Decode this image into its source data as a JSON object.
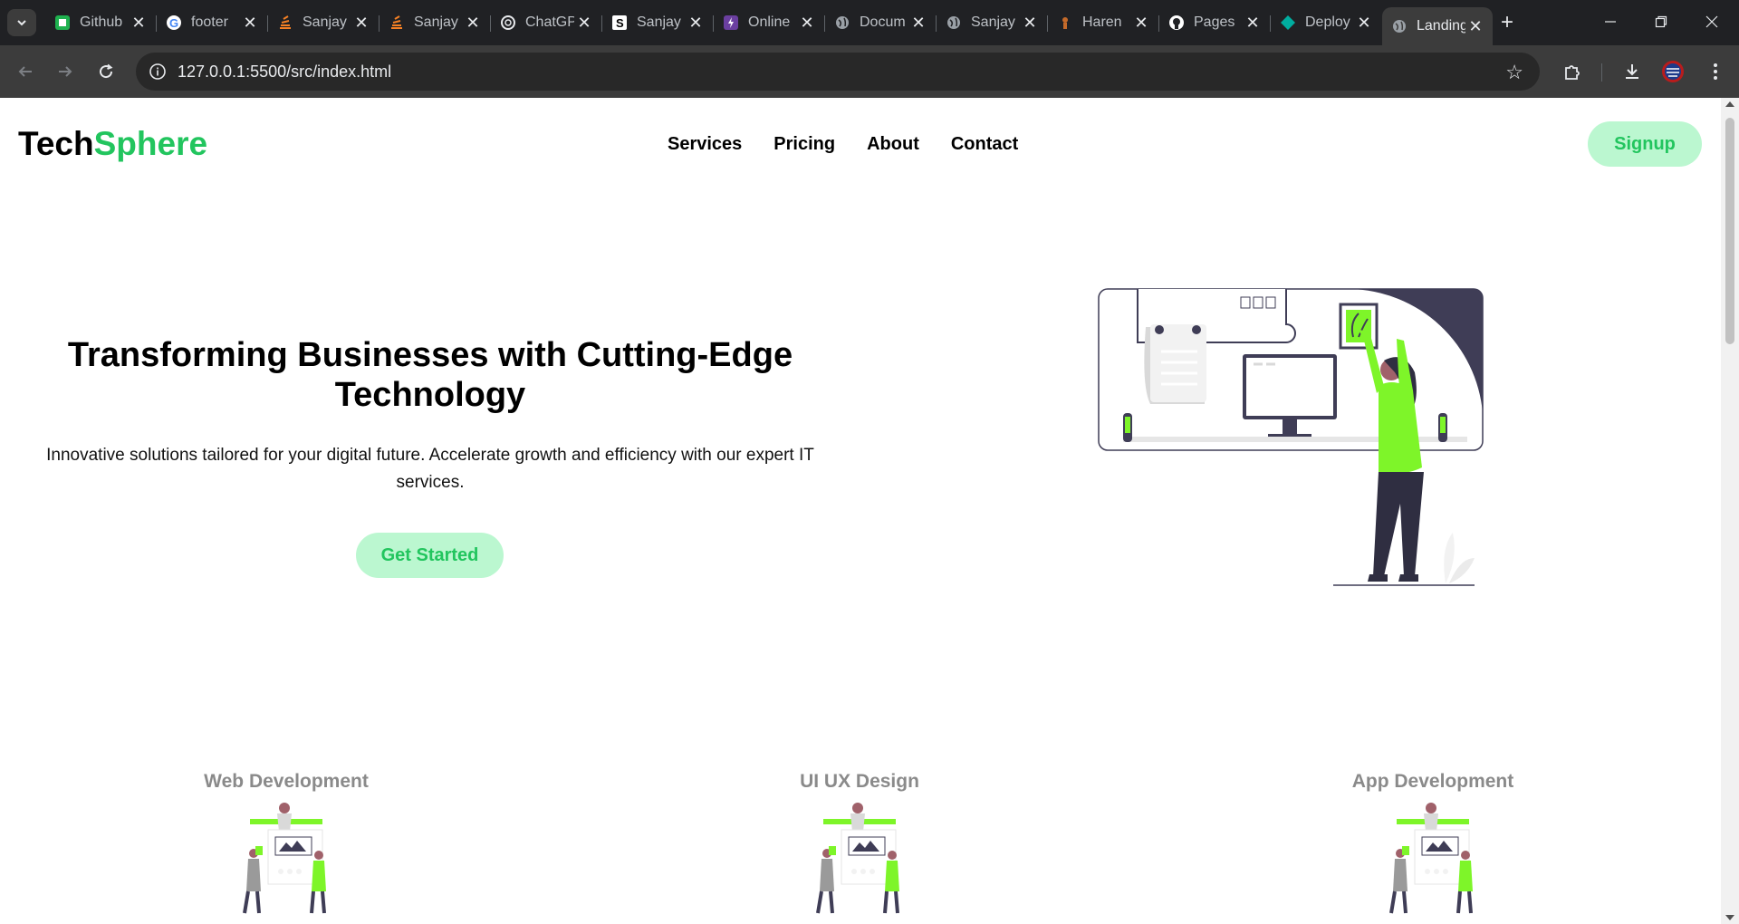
{
  "browser": {
    "tabs": [
      {
        "title": "Github",
        "icon": "green-square-icon"
      },
      {
        "title": "footer",
        "icon": "google-icon"
      },
      {
        "title": "Sanjay",
        "icon": "stackoverflow-icon"
      },
      {
        "title": "Sanjay",
        "icon": "stackoverflow-icon"
      },
      {
        "title": "ChatGPT",
        "icon": "openai-icon"
      },
      {
        "title": "Sanjay",
        "icon": "s-logo-icon"
      },
      {
        "title": "Online",
        "icon": "bolt-icon"
      },
      {
        "title": "Docum",
        "icon": "globe-icon"
      },
      {
        "title": "Sanjay",
        "icon": "globe-icon"
      },
      {
        "title": "Haren",
        "icon": "figure-icon"
      },
      {
        "title": "Pages",
        "icon": "github-icon"
      },
      {
        "title": "Deploy",
        "icon": "diamond-icon"
      },
      {
        "title": "Landing",
        "icon": "globe-icon",
        "active": true
      }
    ],
    "url": "127.0.0.1:5500/src/index.html"
  },
  "page": {
    "logo": {
      "part1": "Tech",
      "part2": "Sphere"
    },
    "nav": {
      "services": "Services",
      "pricing": "Pricing",
      "about": "About",
      "contact": "Contact"
    },
    "signup": "Signup",
    "hero": {
      "title": "Transforming Businesses with Cutting-Edge Technology",
      "subtitle": "Innovative solutions tailored for your digital future. Accelerate growth and efficiency with our expert IT services.",
      "cta": "Get Started"
    },
    "services": [
      "Web Development",
      "UI UX Design",
      "App Development"
    ]
  },
  "colors": {
    "accent": "#22c55e",
    "accent_light": "#bbf7d0",
    "illustration_green": "#7ef529",
    "dark": "#3f3d56"
  }
}
